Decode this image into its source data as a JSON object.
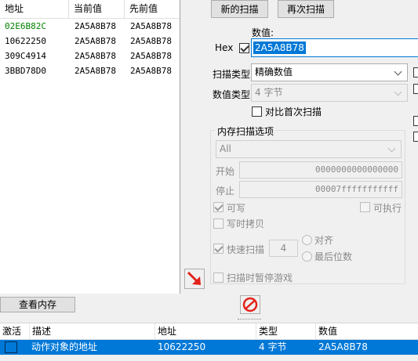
{
  "results": {
    "columns": [
      "地址",
      "当前值",
      "先前值"
    ],
    "rows": [
      {
        "address": "02E6B82C",
        "current": "2A5A8B78",
        "previous": "2A5A8B78",
        "address_color": "#008000"
      },
      {
        "address": "10622250",
        "current": "2A5A8B78",
        "previous": "2A5A8B78",
        "address_color": "#000000"
      },
      {
        "address": "309C4914",
        "current": "2A5A8B78",
        "previous": "2A5A8B78",
        "address_color": "#000000"
      },
      {
        "address": "3BBD78D0",
        "current": "2A5A8B78",
        "previous": "2A5A8B78",
        "address_color": "#000000"
      }
    ]
  },
  "buttons": {
    "new_scan": "新的扫描",
    "next_scan": "再次扫描",
    "view_memory": "查看内存"
  },
  "value": {
    "label": "数值:",
    "hex_label": "Hex",
    "hex_checked": true,
    "input": "2A5A8B78"
  },
  "scan_type": {
    "label": "扫描类型",
    "selected": "精确数值"
  },
  "value_type": {
    "label": "数值类型",
    "selected": "4 字节"
  },
  "compare_first": {
    "label": "对比首次扫描",
    "checked": false
  },
  "memory_options": {
    "title": "内存扫描选项",
    "region": "All",
    "start_label": "开始",
    "start_value": "0000000000000000",
    "stop_label": "停止",
    "stop_value": "00007fffffffffff",
    "writable": {
      "label": "可写",
      "checked": true
    },
    "executable": {
      "label": "可执行",
      "checked": false
    },
    "copy_on_write": {
      "label": "写时拷贝",
      "checked": false
    },
    "fast_scan": {
      "label": "快速扫描",
      "checked": true,
      "value": "4"
    },
    "align_label": "对齐",
    "last_digits_label": "最后位数",
    "pause_game": {
      "label": "扫描时暂停游戏",
      "checked": false
    }
  },
  "address_list": {
    "columns": [
      "激活",
      "描述",
      "地址",
      "类型",
      "数值"
    ],
    "rows": [
      {
        "active": false,
        "description": "动作对象的地址",
        "address": "10622250",
        "type": "4 字节",
        "value": "2A5A8B78"
      }
    ]
  },
  "colors": {
    "selection": "#0078d7",
    "green_address": "#008000",
    "arrow": "#e2231a",
    "stop_icon": "#e2231a"
  }
}
